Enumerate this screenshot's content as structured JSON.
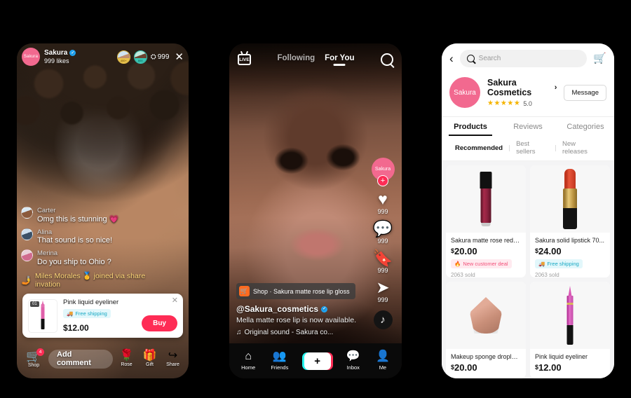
{
  "background_color": "#000000",
  "accent": {
    "tiktok_red": "#fe2c55",
    "cyan": "#25f4ee",
    "pink_brand": "#f2698f",
    "star_gold": "#f5b400"
  },
  "phone_live": {
    "host": {
      "avatar_label": "Sakura",
      "name": "Sakura",
      "verified_icon": "✓",
      "likes": "999 likes"
    },
    "viewers": {
      "badge_1": "400+",
      "badge_2": "600",
      "count": "999",
      "person_icon": "⛭",
      "close_icon": "✕"
    },
    "chat": [
      {
        "name": "Carter",
        "text": "Omg this is stunning 💗",
        "avatar": "viewer-avatar-1"
      },
      {
        "name": "Alina",
        "text": "That sound is so nice!",
        "avatar": "viewer-avatar-2"
      },
      {
        "name": "Merina",
        "text": "Do you ship to Ohio ?",
        "avatar": "viewer-avatar-3"
      }
    ],
    "system_message": {
      "icon": "🤳",
      "text": "Miles Morales 🥇 joined via share invation"
    },
    "product_card": {
      "index": "01",
      "title": "Pink liquid eyeliner",
      "shipping_tag": "Free shipping",
      "shipping_icon": "🚚",
      "price": "$12.00",
      "buy_label": "Buy",
      "close_icon": "✕"
    },
    "bottom_bar": {
      "shop_label": "Shop",
      "shop_icon": "🛒",
      "shop_badge": "4",
      "comment_placeholder": "Add comment",
      "actions": [
        {
          "icon": "🌹",
          "label": "Rose"
        },
        {
          "icon": "🎁",
          "label": "Gift"
        },
        {
          "icon": "↪",
          "label": "Share"
        }
      ]
    }
  },
  "phone_feed": {
    "header": {
      "live_label": "LIVE",
      "tabs": [
        {
          "label": "Following",
          "active": false
        },
        {
          "label": "For You",
          "active": true
        }
      ],
      "search_icon": "search-icon"
    },
    "rail": {
      "avatar_label": "Sakura",
      "follow_icon": "+",
      "actions": [
        {
          "icon": "♥",
          "count": "999",
          "name": "like"
        },
        {
          "icon": "💬",
          "count": "999",
          "name": "comment"
        },
        {
          "icon": "🔖",
          "count": "999",
          "name": "bookmark"
        },
        {
          "icon": "➤",
          "count": "999",
          "name": "share"
        }
      ],
      "disc_icon": "♪"
    },
    "caption": {
      "shop_chip_icon": "🛒",
      "shop_chip_text": "Shop · Sakura matte rose lip gloss",
      "username": "@Sakura_cosmetics",
      "verified_icon": "✓",
      "description": "Mella matte rose lip is now available.",
      "sound_icon": "♫",
      "sound_text": "Original sound - Sakura co..."
    },
    "nav": [
      {
        "icon": "⌂",
        "label": "Home",
        "name": "home"
      },
      {
        "icon": "👥",
        "label": "Friends",
        "name": "friends"
      },
      {
        "icon": "+",
        "label": "",
        "name": "create"
      },
      {
        "icon": "💬",
        "label": "Inbox",
        "name": "inbox"
      },
      {
        "icon": "👤",
        "label": "Me",
        "name": "me"
      }
    ]
  },
  "phone_shop": {
    "top": {
      "back_icon": "‹",
      "search_placeholder": "Search",
      "cart_icon": "🛒"
    },
    "store": {
      "avatar_label": "Sakura",
      "name": "Sakura Cosmetics",
      "chevron": "›",
      "stars": "★★★★★",
      "rating": "5.0",
      "message_label": "Message"
    },
    "tabs": [
      {
        "label": "Products",
        "active": true
      },
      {
        "label": "Reviews",
        "active": false
      },
      {
        "label": "Categories",
        "active": false
      }
    ],
    "subtabs": [
      {
        "label": "Recommended",
        "active": true
      },
      {
        "label": "Best sellers",
        "active": false
      },
      {
        "label": "New releases",
        "active": false
      }
    ],
    "products": [
      {
        "art": "gloss",
        "name": "Sakura matte rose red li ...",
        "currency": "$",
        "price": "20.00",
        "tag": "New customer deal",
        "tag_icon": "🔥",
        "tag_type": "deal",
        "sold": "2063 sold"
      },
      {
        "art": "lipstick",
        "name": "Sakura solid lipstick 70...",
        "currency": "$",
        "price": "24.00",
        "tag": "Free shipping",
        "tag_icon": "🚚",
        "tag_type": "ship",
        "sold": "2063 sold"
      },
      {
        "art": "sponge",
        "name": "Makeup sponge droplet ...",
        "currency": "$",
        "price": "20.00",
        "tag": "",
        "tag_icon": "",
        "tag_type": "",
        "sold": ""
      },
      {
        "art": "liner",
        "name": "Pink liquid eyeliner",
        "currency": "$",
        "price": "12.00",
        "tag": "",
        "tag_icon": "",
        "tag_type": "",
        "sold": ""
      }
    ]
  }
}
